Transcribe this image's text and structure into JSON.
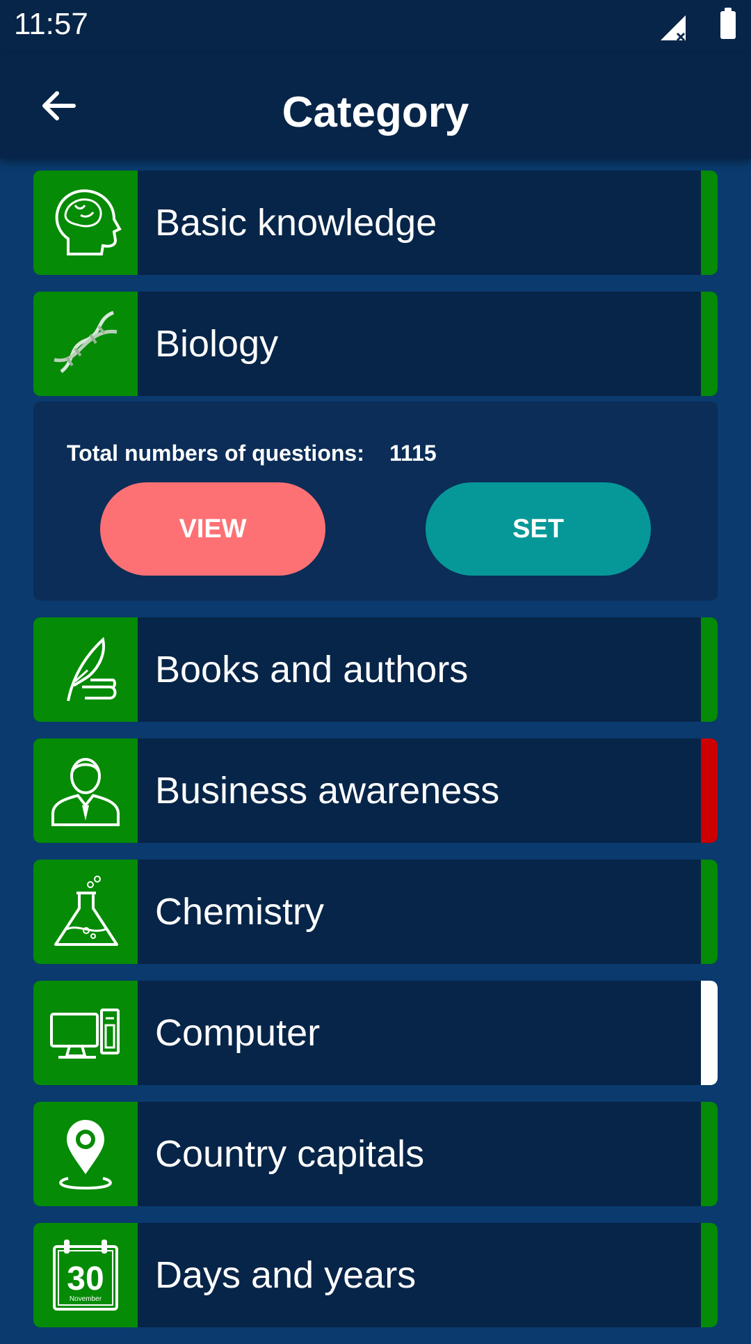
{
  "status_bar": {
    "time": "11:57",
    "icons": [
      "signal-icon",
      "battery-icon"
    ]
  },
  "app_bar": {
    "title": "Category",
    "back_icon": "arrow-left-icon"
  },
  "categories": [
    {
      "label": "Basic knowledge",
      "icon": "head-icon",
      "status_color": "#058b05"
    },
    {
      "label": "Biology",
      "icon": "dna-icon",
      "status_color": "#058b05"
    },
    {
      "label": "Books and authors",
      "icon": "quill-book-icon",
      "status_color": "#058b05"
    },
    {
      "label": "Business awareness",
      "icon": "businessman-icon",
      "status_color": "#cc0000"
    },
    {
      "label": "Chemistry",
      "icon": "flask-icon",
      "status_color": "#058b05"
    },
    {
      "label": "Computer",
      "icon": "computer-icon",
      "status_color": "#ffffff"
    },
    {
      "label": "Country capitals",
      "icon": "location-pin-icon",
      "status_color": "#058b05"
    },
    {
      "label": "Days and years",
      "icon": "calendar-icon",
      "status_color": "#058b05",
      "calendar_day": "30",
      "calendar_month": "November"
    }
  ],
  "expanded": {
    "questions_label": "Total numbers of questions:",
    "questions_count": "1115",
    "view_label": "VIEW",
    "set_label": "SET"
  },
  "colors": {
    "icon_bg": "#058b05",
    "view_btn": "#fd7174",
    "set_btn": "#069898",
    "background": "#0a3a6e",
    "card": "#072548"
  }
}
